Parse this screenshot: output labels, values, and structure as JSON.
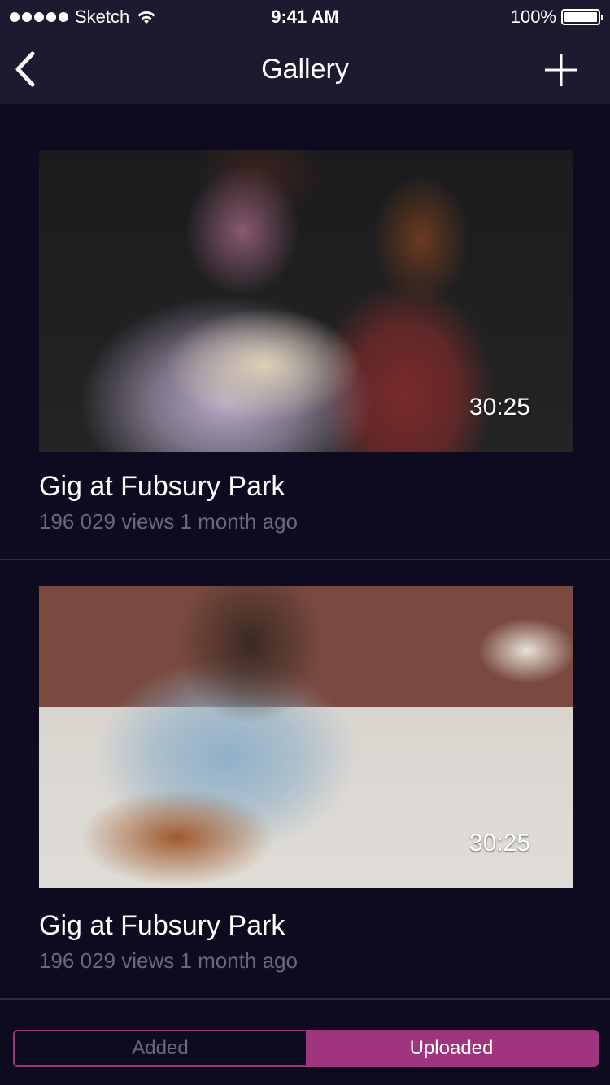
{
  "status_bar": {
    "carrier": "Sketch",
    "time": "9:41 AM",
    "battery": "100%"
  },
  "nav": {
    "title": "Gallery",
    "back_icon": "chevron-left-icon",
    "add_icon": "plus-icon"
  },
  "videos": [
    {
      "title": "Gig at Fubsury Park",
      "meta": "196 029 views 1 month ago",
      "duration": "30:25"
    },
    {
      "title": "Gig at Fubsury Park",
      "meta": "196 029 views 1 month ago",
      "duration": "30:25"
    }
  ],
  "segmented": {
    "options": [
      "Added",
      "Uploaded"
    ],
    "selected": "Uploaded"
  },
  "colors": {
    "background": "#0e0b20",
    "bar": "#1c1a2e",
    "accent": "#a0357f",
    "muted_text": "#6a6878"
  }
}
